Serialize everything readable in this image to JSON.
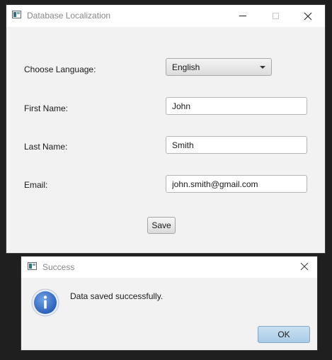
{
  "main_window": {
    "title": "Database Localization",
    "form": {
      "language_label": "Choose Language:",
      "language_value": "English",
      "first_name_label": "First Name:",
      "first_name_value": "John",
      "last_name_label": "Last Name:",
      "last_name_value": "Smith",
      "email_label": "Email:",
      "email_value": "john.smith@gmail.com",
      "save_label": "Save"
    }
  },
  "dialog": {
    "title": "Success",
    "message": "Data saved successfully.",
    "ok_label": "OK",
    "icon": "info-icon"
  },
  "icons": {
    "app": "app-window-icon",
    "minimize": "minimize-icon",
    "maximize": "maximize-icon",
    "close": "close-icon",
    "dropdown": "chevron-down-icon"
  },
  "colors": {
    "title_text": "#888888",
    "ok_button": "#b8d5ec",
    "info_icon": "#2f6fc7"
  }
}
